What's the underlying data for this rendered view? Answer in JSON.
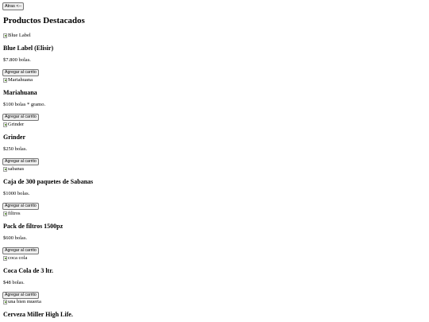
{
  "back_button": {
    "label": "Atras <--"
  },
  "page_title": "Productos Destacados",
  "products": [
    {
      "img_alt": "Blue Label",
      "name": "Blue Label (Elisir)",
      "price": "$7.800 bolas.",
      "button": "Agregar al carrito"
    },
    {
      "img_alt": "Mariahuana",
      "name": "Mariahuana",
      "price": "$100 bolas * gramo.",
      "button": "Agregar al carrito"
    },
    {
      "img_alt": "Grinder",
      "name": "Grinder",
      "price": "$250 bolas.",
      "button": "Agregar al carrito"
    },
    {
      "img_alt": "sabanas",
      "name": "Caja de 300 paquetes de Sabanas",
      "price": "$1000 bolas.",
      "button": "Agregar al carrito"
    },
    {
      "img_alt": "filtros",
      "name": "Pack de filtros 1500pz",
      "price": "$600 bolas.",
      "button": "Agregar al carrito"
    },
    {
      "img_alt": "coca cola",
      "name": "Coca Cola de 3 ltr.",
      "price": "$48 bolas.",
      "button": "Agregar al carrito"
    },
    {
      "img_alt": "una bien muerta",
      "name": "Cerveza Miller High Life.",
      "price": "",
      "button": ""
    }
  ]
}
